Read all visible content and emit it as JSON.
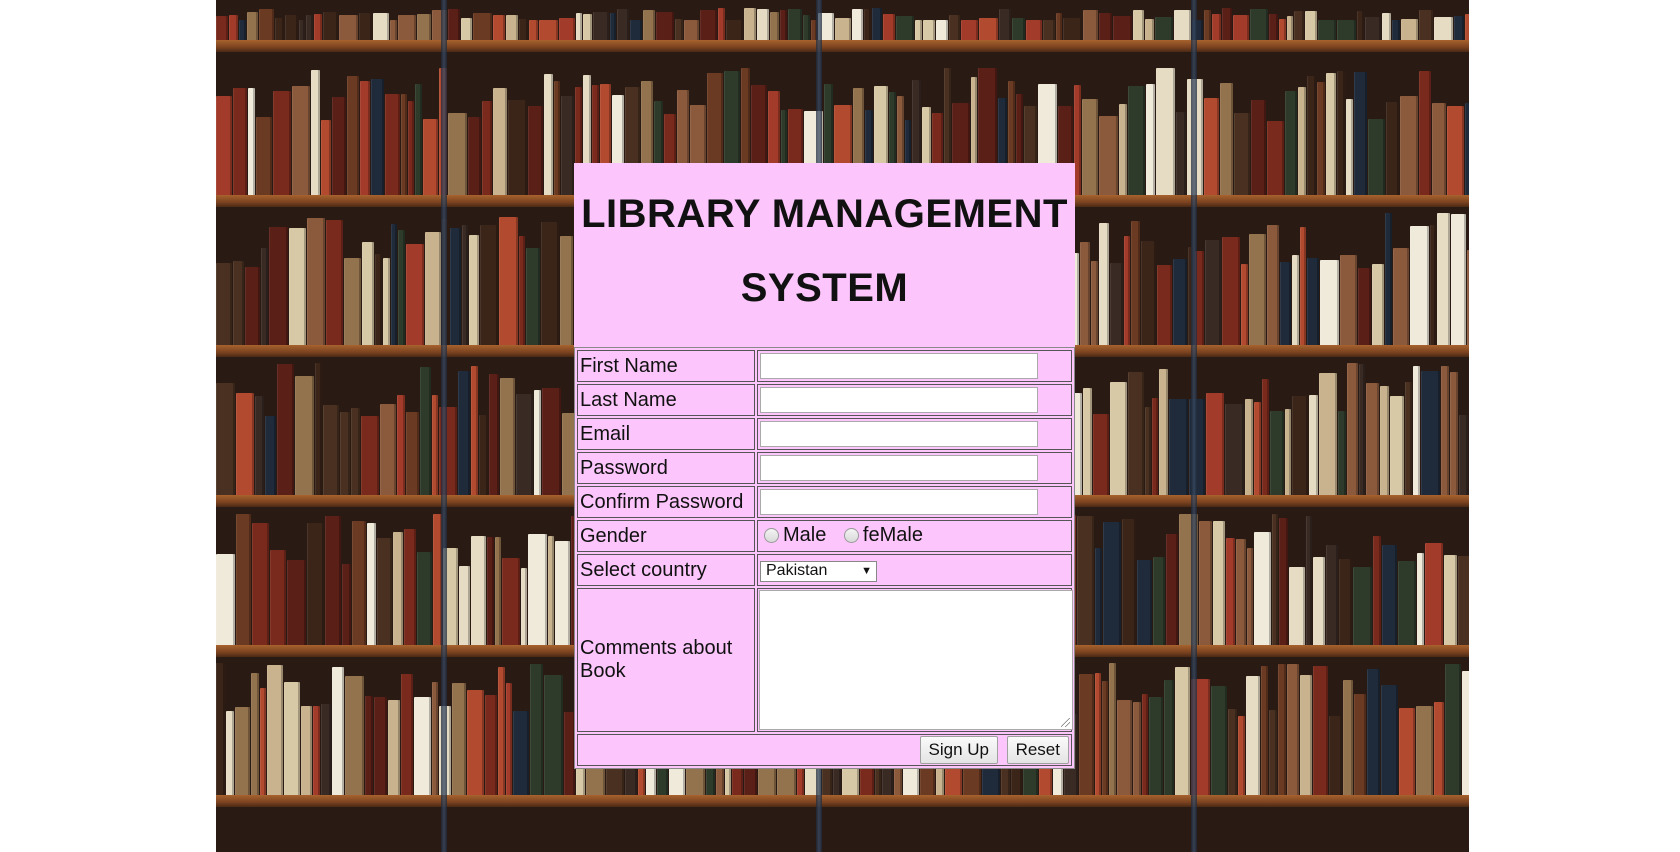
{
  "page": {
    "title_line1": "LIBRARY MANAGEMENT",
    "title_line2": "SYSTEM"
  },
  "form": {
    "first_name_label": "First Name",
    "last_name_label": "Last Name",
    "email_label": "Email",
    "password_label": "Password",
    "confirm_password_label": "Confirm Password",
    "gender_label": "Gender",
    "gender_options": [
      "Male",
      "feMale"
    ],
    "country_label": "Select country",
    "country_selected": "Pakistan",
    "comments_label": "Comments about Book",
    "first_name_value": "",
    "last_name_value": "",
    "email_value": "",
    "password_value": "",
    "confirm_password_value": ""
  },
  "buttons": {
    "signup_label": "Sign Up",
    "reset_label": "Reset"
  },
  "colors": {
    "panel_bg": "#fcc6fc",
    "background": "bookshelf photo"
  }
}
